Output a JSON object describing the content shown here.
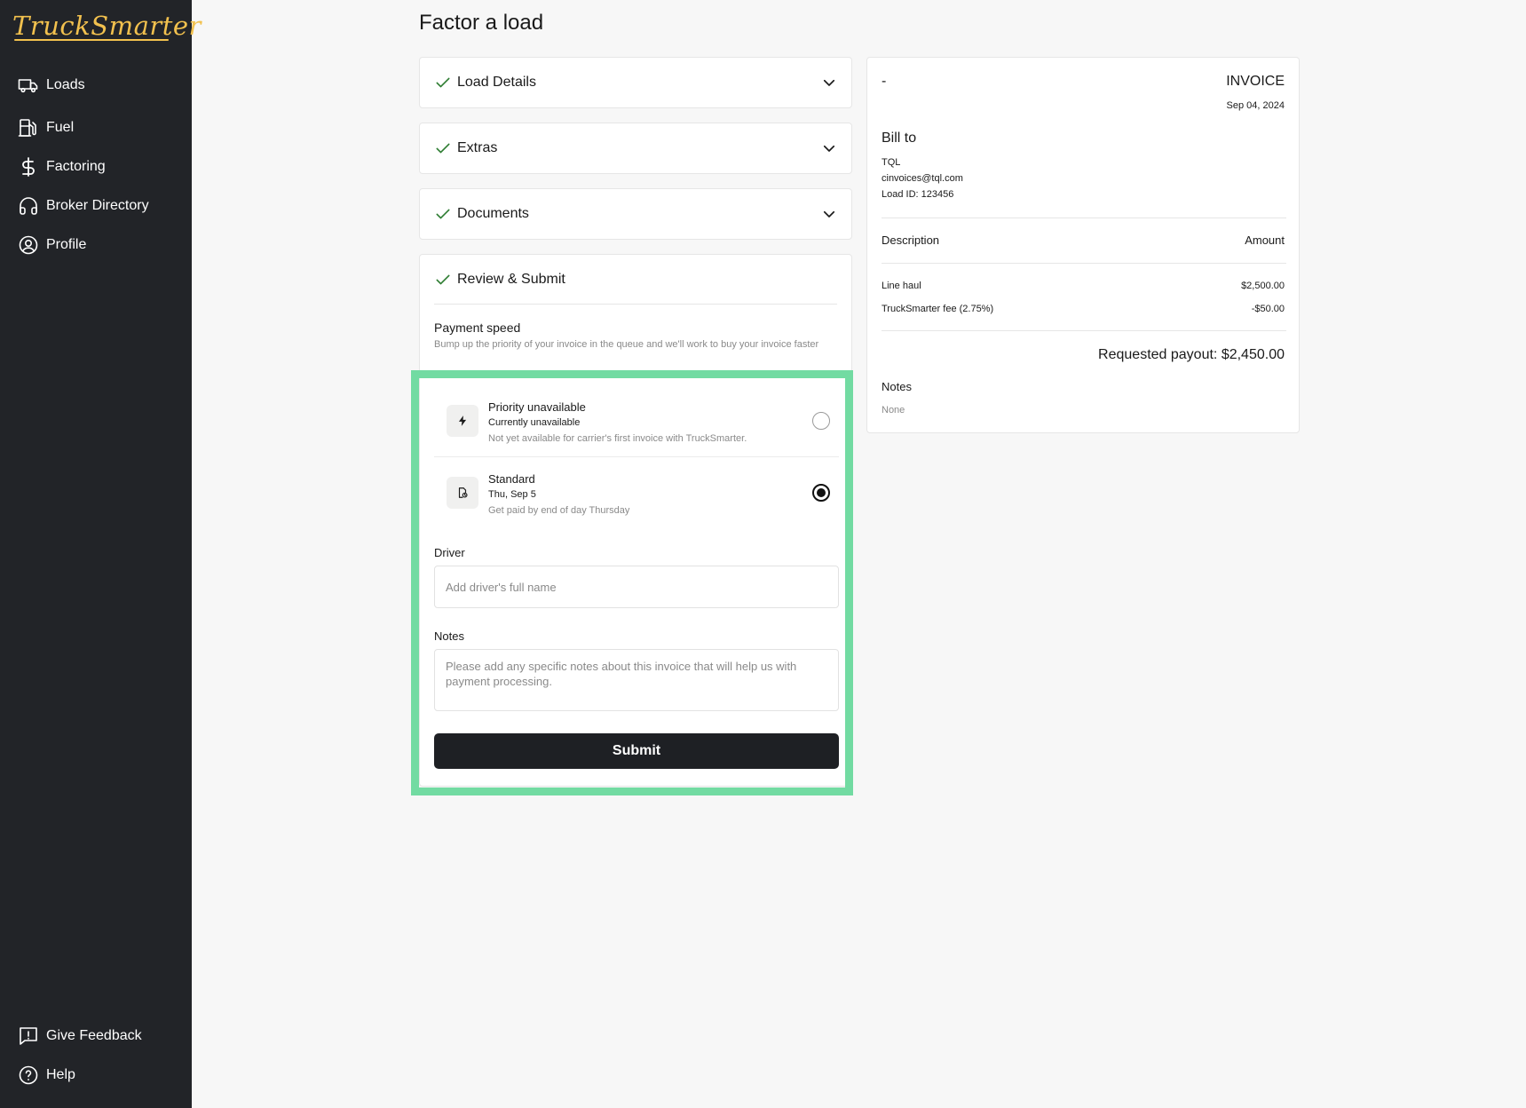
{
  "brand": {
    "logo_text": "TruckSmarter",
    "accent": "#f2c14e"
  },
  "sidebar": {
    "items": [
      {
        "label": "Loads",
        "icon": "truck-icon"
      },
      {
        "label": "Fuel",
        "icon": "fuel-pump-icon"
      },
      {
        "label": "Factoring",
        "icon": "dollar-icon"
      },
      {
        "label": "Broker Directory",
        "icon": "headset-icon"
      },
      {
        "label": "Profile",
        "icon": "user-circle-icon"
      }
    ],
    "bottom": [
      {
        "label": "Give Feedback",
        "icon": "feedback-icon"
      },
      {
        "label": "Help",
        "icon": "help-icon"
      }
    ]
  },
  "page": {
    "title": "Factor a load"
  },
  "steps": [
    {
      "title": "Load Details"
    },
    {
      "title": "Extras"
    },
    {
      "title": "Documents"
    },
    {
      "title": "Review & Submit"
    }
  ],
  "review": {
    "payment_speed_label": "Payment speed",
    "payment_speed_desc": "Bump up the priority of your invoice in the queue and we'll work to buy your invoice faster",
    "options": [
      {
        "title": "Priority unavailable",
        "subtitle": "Currently unavailable",
        "note": "Not yet available for carrier's first invoice with TruckSmarter.",
        "icon": "lightning-icon",
        "selected": false
      },
      {
        "title": "Standard",
        "subtitle": "Thu, Sep 5",
        "note": "Get paid by end of day Thursday",
        "icon": "document-clock-icon",
        "selected": true
      }
    ],
    "driver_label": "Driver",
    "driver_placeholder": "Add driver's full name",
    "driver_value": "",
    "notes_label": "Notes",
    "notes_placeholder": "Please add any specific notes about this invoice that will help us with payment processing.",
    "notes_value": "",
    "submit_label": "Submit"
  },
  "invoice": {
    "dash": "-",
    "title": "INVOICE",
    "date": "Sep 04, 2024",
    "bill_to_label": "Bill to",
    "bill_to_name": "TQL",
    "bill_to_email": "cinvoices@tql.com",
    "load_id": "Load ID: 123456",
    "description_header": "Description",
    "amount_header": "Amount",
    "rows": [
      {
        "description": "Line haul",
        "amount": "$2,500.00"
      },
      {
        "description": "TruckSmarter fee (2.75%)",
        "amount": "-$50.00"
      }
    ],
    "payout": "Requested payout: $2,450.00",
    "notes_label": "Notes",
    "notes_value": "None"
  },
  "colors": {
    "sidebar_bg": "#222428",
    "check_green": "#2e7d32",
    "highlight_border": "#72dba2",
    "submit_bg": "#1e2024"
  }
}
